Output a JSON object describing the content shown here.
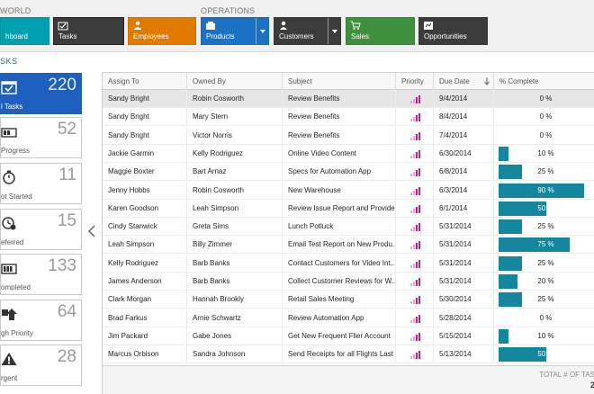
{
  "ribbon": {
    "groups": [
      {
        "label": "WORLD"
      },
      {
        "label": "OPERATIONS"
      }
    ],
    "tiles": [
      {
        "label": "hboard",
        "color": "#00a0b0"
      },
      {
        "label": "Tasks",
        "color": "#3c3c3c"
      },
      {
        "label": "Employees",
        "color": "#e07b00"
      },
      {
        "label": "Products",
        "color": "#1b72c4"
      },
      {
        "label": "Customers",
        "color": "#3c3c3c"
      },
      {
        "label": "Sales",
        "color": "#3e8f3e"
      },
      {
        "label": "Opportunities",
        "color": "#3c3c3c"
      }
    ]
  },
  "section_title": "SKS",
  "stats": [
    {
      "count": "220",
      "label": "l Tasks"
    },
    {
      "count": "52",
      "label": "Progress"
    },
    {
      "count": "11",
      "label": "ot Started"
    },
    {
      "count": "15",
      "label": "eferred"
    },
    {
      "count": "133",
      "label": "ompleted"
    },
    {
      "count": "64",
      "label": "gh Priority"
    },
    {
      "count": "28",
      "label": "rgent"
    }
  ],
  "grid": {
    "columns": [
      "Assign To",
      "Owned By",
      "Subject",
      "Priority",
      "Due Date",
      "% Complete"
    ],
    "rows": [
      {
        "assign": "Sandy Bright",
        "owner": "Robin Cosworth",
        "subject": "Review Benefits",
        "due": "9/4/2014",
        "pct_label": "0 %",
        "pct": 0
      },
      {
        "assign": "Sandy Bright",
        "owner": "Mary Stern",
        "subject": "Review Benefits",
        "due": "8/4/2014",
        "pct_label": "0 %",
        "pct": 0
      },
      {
        "assign": "Sandy Bright",
        "owner": "Victor Norris",
        "subject": "Review Benefits",
        "due": "7/4/2014",
        "pct_label": "0 %",
        "pct": 0
      },
      {
        "assign": "Jackie Garmin",
        "owner": "Kelly Rodriguez",
        "subject": "Online Video Content",
        "due": "6/30/2014",
        "pct_label": "10 %",
        "pct": 10
      },
      {
        "assign": "Maggie Boxter",
        "owner": "Bart Arnaz",
        "subject": "Specs for Automation App",
        "due": "6/8/2014",
        "pct_label": "25 %",
        "pct": 25
      },
      {
        "assign": "Jenny Hobbs",
        "owner": "Robin Cosworth",
        "subject": "New Warehouse",
        "due": "6/3/2014",
        "pct_label": "90 %",
        "pct": 90
      },
      {
        "assign": "Karen Goodson",
        "owner": "Leah Simpson",
        "subject": "Review Issue Report and Provide...",
        "due": "6/1/2014",
        "pct_label": "50 %",
        "pct": 50
      },
      {
        "assign": "Cindy Stanwick",
        "owner": "Greta Sims",
        "subject": "Lunch Potluck",
        "due": "5/31/2014",
        "pct_label": "25 %",
        "pct": 25
      },
      {
        "assign": "Leah Simpson",
        "owner": "Billy Zimmer",
        "subject": "Email Test Report on New Produ...",
        "due": "5/31/2014",
        "pct_label": "75 %",
        "pct": 75
      },
      {
        "assign": "Kelly Rodriguez",
        "owner": "Barb Banks",
        "subject": "Contact Customers for Video Int...",
        "due": "5/31/2014",
        "pct_label": "25 %",
        "pct": 25
      },
      {
        "assign": "James Anderson",
        "owner": "Barb Banks",
        "subject": "Collect Customer Reviews for W...",
        "due": "5/31/2014",
        "pct_label": "20 %",
        "pct": 20
      },
      {
        "assign": "Clark Morgan",
        "owner": "Hannah Brookly",
        "subject": "Retail Sales Meeting",
        "due": "5/30/2014",
        "pct_label": "25 %",
        "pct": 25
      },
      {
        "assign": "Brad Farkus",
        "owner": "Arnie Schwartz",
        "subject": "Review Automation App",
        "due": "5/28/2014",
        "pct_label": "0 %",
        "pct": 0
      },
      {
        "assign": "Jim Packard",
        "owner": "Gabe Jones",
        "subject": "Get New Frequent Flier Account",
        "due": "5/15/2014",
        "pct_label": "10 %",
        "pct": 10
      },
      {
        "assign": "Marcus Orbison",
        "owner": "Sandra Johnson",
        "subject": "Send Receipts for all Flights Last ...",
        "due": "5/13/2014",
        "pct_label": "50 %",
        "pct": 50
      }
    ],
    "footer_label": "TOTAL # OF TAS",
    "footer_value": "2"
  },
  "colors": {
    "accent": "#1f5fbe",
    "progress": "#14869e",
    "priority": "#c81e8c"
  }
}
